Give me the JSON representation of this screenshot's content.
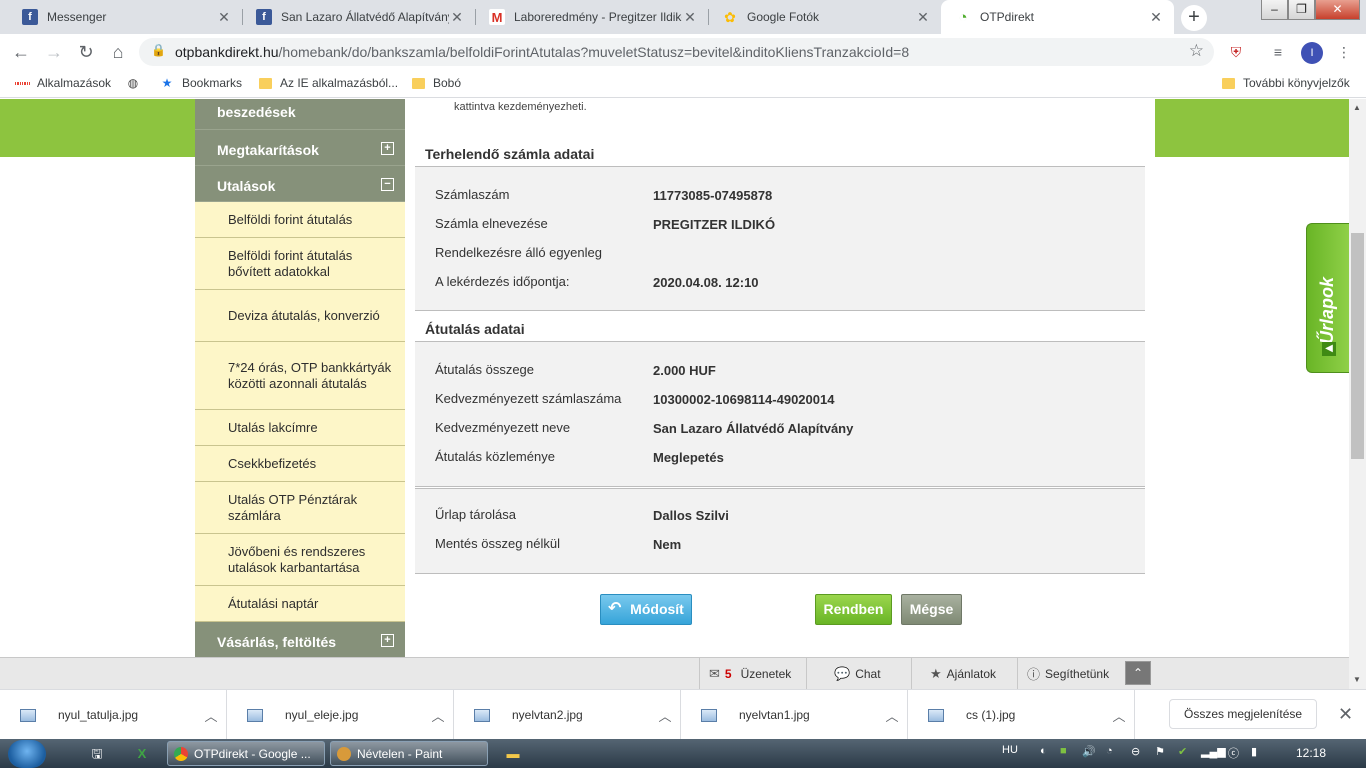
{
  "browser": {
    "tabs": [
      {
        "title": "Messenger",
        "favicon": "facebook-icon"
      },
      {
        "title": "San Lazaro Állatvédő Alapítvány",
        "favicon": "facebook-icon"
      },
      {
        "title": "Laboreredmény - Pregitzer Ildikó",
        "favicon": "gmail-icon"
      },
      {
        "title": "Google Fotók",
        "favicon": "google-photos-icon"
      },
      {
        "title": "OTPdirekt",
        "favicon": "otp-icon",
        "active": true
      }
    ],
    "url_domain": "otpbankdirekt.hu",
    "url_path": "/homebank/do/bankszamla/belfoldiForintAtutalas?muveletStatusz=bevitel&inditoKliensTranzakcioId=8",
    "profile_initial": "I",
    "bookmarks": [
      "Alkalmazások",
      "Bookmarks",
      "Az IE alkalmazásból...",
      "Bobó"
    ],
    "other_bookmarks": "További könyvjelzők"
  },
  "sidebar": {
    "partial_heading": "beszedések",
    "megtakaritasok": "Megtakarítások",
    "utalasok": "Utalások",
    "items": [
      "Belföldi forint átutalás",
      "Belföldi forint átutalás bővített adatokkal",
      "Deviza átutalás, konverzió",
      "7*24 órás, OTP bankkártyák közötti azonnali átutalás",
      "Utalás lakcímre",
      "Csekkbefizetés",
      "Utalás OTP Pénztárak számlára",
      "Jövőbeni és rendszeres utalások karbantartása",
      "Átutalási naptár"
    ],
    "vasarlas": "Vásárlás, feltöltés"
  },
  "main": {
    "intro_fragment": "kattintva kezdeményezheti.",
    "debit_section": {
      "title": "Terhelendő számla adatai",
      "rows": [
        {
          "label": "Számlaszám",
          "value": "11773085-07495878"
        },
        {
          "label": "Számla elnevezése",
          "value": "PREGITZER ILDIKÓ"
        },
        {
          "label": "Rendelkezésre álló egyenleg",
          "value": ""
        },
        {
          "label": "A lekérdezés időpontja:",
          "value": "2020.04.08. 12:10"
        }
      ]
    },
    "transfer_section": {
      "title": "Átutalás adatai",
      "rows": [
        {
          "label": "Átutalás összege",
          "value": "2.000 HUF"
        },
        {
          "label": "Kedvezményezett számlaszáma",
          "value": "10300002-10698114-49020014"
        },
        {
          "label": "Kedvezményezett neve",
          "value": "San Lazaro Állatvédő Alapítvány"
        },
        {
          "label": "Átutalás közleménye",
          "value": "Meglepetés"
        }
      ]
    },
    "form_section": {
      "rows": [
        {
          "label": "Űrlap tárolása",
          "value": "Dallos Szilvi"
        },
        {
          "label": "Mentés összeg nélkül",
          "value": "Nem"
        }
      ]
    },
    "buttons": {
      "modify": "Módosít",
      "ok": "Rendben",
      "cancel": "Mégse"
    }
  },
  "forms_tab": "Űrlapok",
  "site_bar": {
    "messages_count": "5",
    "messages": "Üzenetek",
    "chat": "Chat",
    "offers": "Ajánlatok",
    "help": "Segíthetünk"
  },
  "downloads": {
    "items": [
      "nyul_tatulja.jpg",
      "nyul_eleje.jpg",
      "nyelvtan2.jpg",
      "nyelvtan1.jpg",
      "cs (1).jpg"
    ],
    "show_all": "Összes megjelenítése"
  },
  "taskbar": {
    "tasks": [
      "OTPdirekt - Google ...",
      "Névtelen - Paint"
    ],
    "language": "HU",
    "time": "12:18"
  },
  "colors": {
    "green": "#8dc43f",
    "sidebar_head": "#86917a",
    "sidebar_item": "#fdf6c8"
  }
}
